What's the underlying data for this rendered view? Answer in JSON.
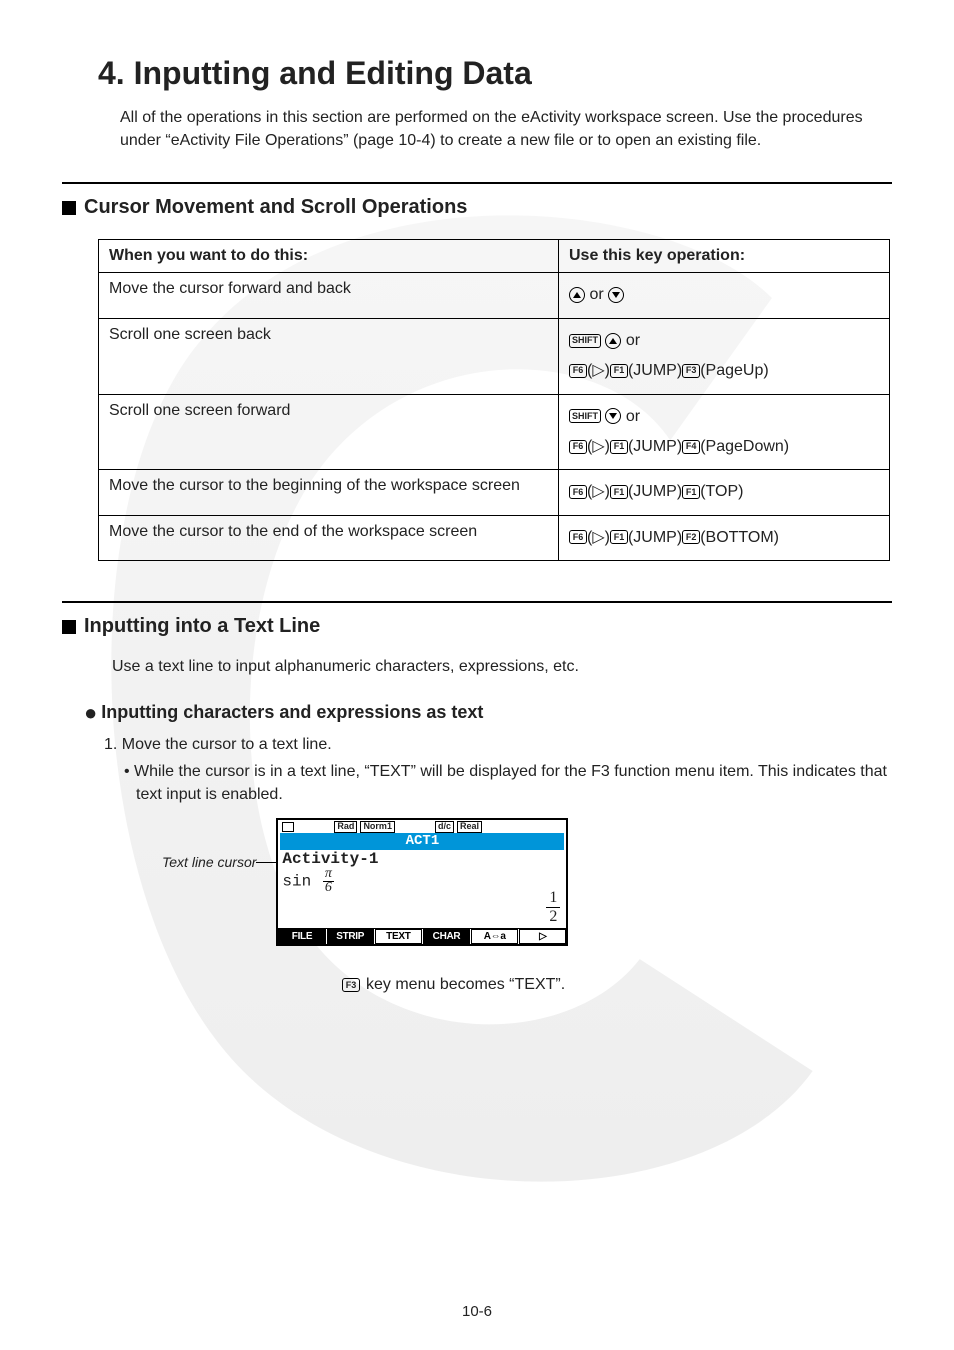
{
  "page": {
    "title": "4. Inputting and Editing Data",
    "intro": "All of the operations in this section are performed on the eActivity workspace screen. Use the procedures under “eActivity File Operations” (page 10-4) to create a new file or to open an existing file.",
    "page_number": "10-6"
  },
  "section_cursor": {
    "heading": "Cursor Movement and Scroll Operations",
    "table": {
      "header": {
        "c1": "When you want to do this:",
        "c2": "Use this key operation:"
      },
      "rows": [
        {
          "c1": "Move the cursor forward and back",
          "op": "up_or_down"
        },
        {
          "c1": "Scroll one screen back",
          "op": "scroll_back"
        },
        {
          "c1": "Scroll one screen forward",
          "op": "scroll_forward"
        },
        {
          "c1": "Move the cursor to the beginning of the workspace screen",
          "op": "jump_top"
        },
        {
          "c1": "Move the cursor to the end of the workspace screen",
          "op": "jump_bottom"
        }
      ]
    },
    "keylabels": {
      "shift": "SHIFT",
      "f1": "F1",
      "f2": "F2",
      "f3": "F3",
      "f4": "F4",
      "f6": "F6",
      "jump": "JUMP",
      "pageup": "PageUp",
      "pagedown": "PageDown",
      "top": "TOP",
      "bottom": "BOTTOM",
      "or": " or "
    }
  },
  "section_input": {
    "heading": "Inputting into a Text Line",
    "desc": "Use a text line to input alphanumeric characters, expressions, etc."
  },
  "sub_section": {
    "heading": "Inputting characters and expressions as text",
    "step1": "1. Move the cursor to a text line.",
    "bullet": "While the cursor is in a text line, “TEXT” will be displayed for the F3 function menu item. This indicates that text input is enabled.",
    "cursor_label": "Text line cursor",
    "below": " key menu becomes “TEXT”."
  },
  "calc": {
    "status_badges": [
      "Rad",
      "Norm1",
      "d/c",
      "Real"
    ],
    "title": "ACT1",
    "line1": "Activity-1",
    "expr_prefix": "sin ",
    "frac_n": "π",
    "frac_d": "6",
    "result_n": "1",
    "result_d": "2",
    "fmenu": [
      "FILE",
      "STRIP",
      "TEXT",
      "CHAR",
      "A⇔a",
      "▷"
    ]
  }
}
